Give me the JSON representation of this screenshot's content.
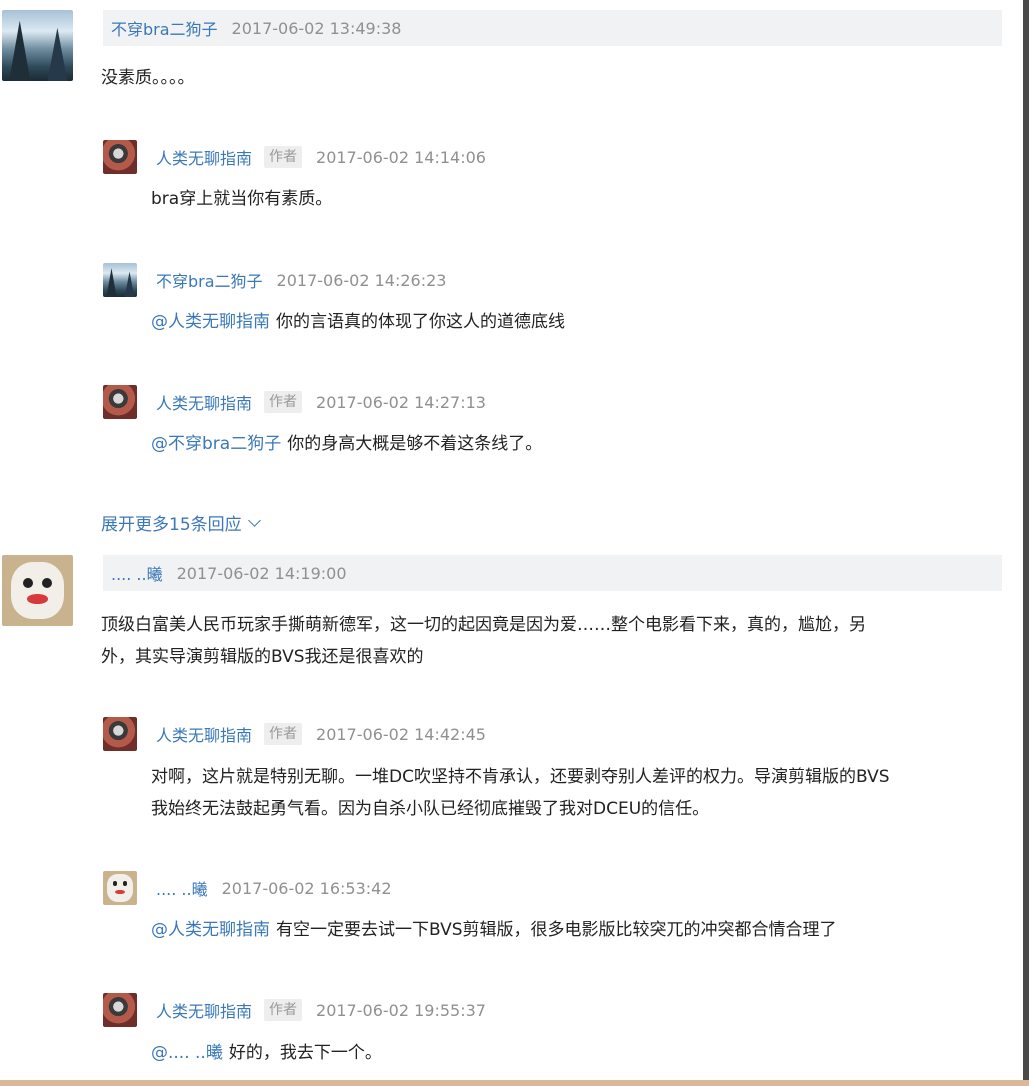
{
  "comments": [
    {
      "user": "不穿bra二狗子",
      "time": "2017-06-02 13:49:38",
      "text": "没素质。。。。",
      "replies": [
        {
          "user": "人类无聊指南",
          "tag": "作者",
          "time": "2017-06-02 14:14:06",
          "mention": "",
          "text": "bra穿上就当你有素质。"
        },
        {
          "user": "不穿bra二狗子",
          "tag": "",
          "time": "2017-06-02 14:26:23",
          "mention": "@人类无聊指南",
          "text": "你的言语真的体现了你这人的道德底线"
        },
        {
          "user": "人类无聊指南",
          "tag": "作者",
          "time": "2017-06-02 14:27:13",
          "mention": "@不穿bra二狗子",
          "text": "你的身高大概是够不着这条线了。"
        }
      ],
      "expand_label": "展开更多15条回应"
    },
    {
      "user": ".... ..曦",
      "time": "2017-06-02 14:19:00",
      "text_line1": "顶级白富美人民币玩家手撕萌新德军，这一切的起因竟是因为爱……整个电影看下来，真的，尴尬，另",
      "text_line2": "外，其实导演剪辑版的BVS我还是很喜欢的",
      "replies": [
        {
          "user": "人类无聊指南",
          "tag": "作者",
          "time": "2017-06-02 14:42:45",
          "mention": "",
          "text_line1": "对啊，这片就是特别无聊。一堆DC吹坚持不肯承认，还要剥夺别人差评的权力。导演剪辑版的BVS",
          "text_line2": "我始终无法鼓起勇气看。因为自杀小队已经彻底摧毁了我对DCEU的信任。"
        },
        {
          "user": ".... ..曦",
          "tag": "",
          "time": "2017-06-02 16:53:42",
          "mention": "@人类无聊指南",
          "text": "有空一定要去试一下BVS剪辑版，很多电影版比较突兀的冲突都合情合理了"
        },
        {
          "user": "人类无聊指南",
          "tag": "作者",
          "time": "2017-06-02 19:55:37",
          "mention": "@.... ..曦",
          "text": "好的，我去下一个。"
        }
      ]
    }
  ],
  "colors": {
    "link": "#3b78b9",
    "header_bg": "#f1f2f3",
    "time": "#909090"
  },
  "icons": {
    "expand": "chevron-down-icon"
  }
}
